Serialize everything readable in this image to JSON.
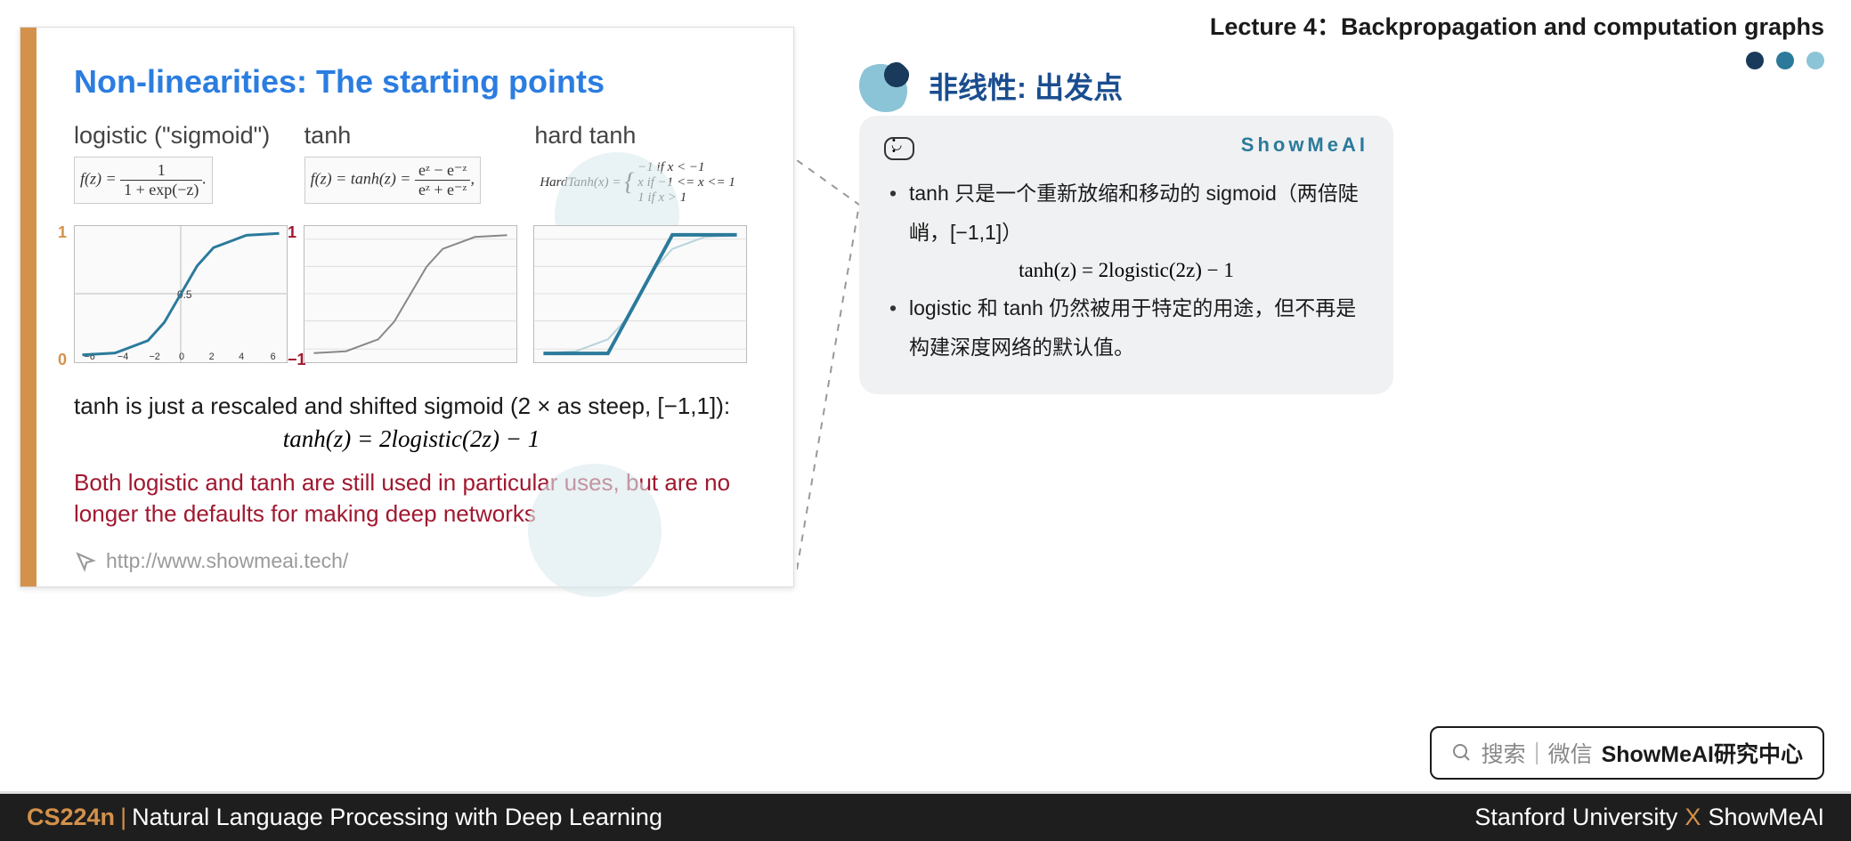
{
  "header": {
    "lecture": "Lecture 4：Backpropagation and computation graphs"
  },
  "slide": {
    "title": "Non-linearities: The starting points",
    "func1_label": "logistic (\"sigmoid\")",
    "func1_eq_prefix": "f(z) = ",
    "func1_eq_num": "1",
    "func1_eq_den": "1 + exp(−z)",
    "func2_label": "tanh",
    "func2_eq_prefix": "f(z) = tanh(z) = ",
    "func2_eq_num": "eᶻ − e⁻ᶻ",
    "func2_eq_den": "eᶻ + e⁻ᶻ",
    "func3_label": "hard tanh",
    "func3_eq_l": "HardTanh(x) = ",
    "func3_eq_r1": "−1   if x < −1",
    "func3_eq_r2": "  x   if −1 <= x <= 1",
    "func3_eq_r3": "  1   if x > 1",
    "axis": {
      "sig0": "0",
      "sig1": "1",
      "tanhn1": "−1",
      "tanh1": "1"
    },
    "note": "tanh is just a rescaled and shifted sigmoid (2 × as steep, [−1,1]):",
    "formula": "tanh(z) = 2logistic(2z) − 1",
    "red": "Both logistic and tanh are still used in particular uses, but are no longer the defaults for making deep networks",
    "link": "http://www.showmeai.tech/"
  },
  "side": {
    "title": "非线性: 出发点",
    "brand": "ShowMeAI",
    "b1": "tanh 只是一个重新放缩和移动的 sigmoid（两倍陡峭，[−1,1]）",
    "formula": "tanh(z) = 2logistic(2z) − 1",
    "b2": "logistic 和 tanh 仍然被用于特定的用途，但不再是构建深度网络的默认值。"
  },
  "search": {
    "icon": "",
    "label": "搜索｜微信",
    "bold": "ShowMeAI研究中心"
  },
  "footer": {
    "course": "CS224n",
    "subtitle": "Natural Language Processing with Deep Learning",
    "uni": "Stanford University",
    "brand": "ShowMeAI"
  },
  "chart_data": [
    {
      "type": "line",
      "name": "logistic",
      "xlim": [
        -6,
        6
      ],
      "ylim": [
        0,
        1
      ],
      "xticks": [
        -6,
        -4,
        -2,
        0,
        2,
        4,
        6
      ],
      "yticks": [
        0,
        0.5,
        1
      ],
      "points": [
        [
          -6,
          0.0025
        ],
        [
          -4,
          0.018
        ],
        [
          -2,
          0.119
        ],
        [
          -1,
          0.269
        ],
        [
          0,
          0.5
        ],
        [
          1,
          0.731
        ],
        [
          2,
          0.881
        ],
        [
          4,
          0.982
        ],
        [
          6,
          0.9975
        ]
      ]
    },
    {
      "type": "line",
      "name": "tanh",
      "xlim": [
        -3,
        3
      ],
      "ylim": [
        -1,
        1
      ],
      "yticks": [
        -1,
        -0.8,
        -0.6,
        -0.4,
        -0.2,
        0,
        0.2,
        0.4,
        0.6,
        0.8,
        1
      ],
      "points": [
        [
          -3,
          -0.995
        ],
        [
          -2,
          -0.964
        ],
        [
          -1,
          -0.762
        ],
        [
          -0.5,
          -0.462
        ],
        [
          0,
          0
        ],
        [
          0.5,
          0.462
        ],
        [
          1,
          0.762
        ],
        [
          2,
          0.964
        ],
        [
          3,
          0.995
        ]
      ]
    },
    {
      "type": "line",
      "name": "hardtanh",
      "xlim": [
        -3,
        3
      ],
      "ylim": [
        -1,
        1
      ],
      "yticks": [
        -1,
        -0.8,
        -0.6,
        -0.4,
        -0.2,
        0,
        0.2,
        0.4,
        0.6,
        0.8,
        1
      ],
      "points": [
        [
          -3,
          -1
        ],
        [
          -1,
          -1
        ],
        [
          1,
          1
        ],
        [
          3,
          1
        ]
      ]
    }
  ]
}
